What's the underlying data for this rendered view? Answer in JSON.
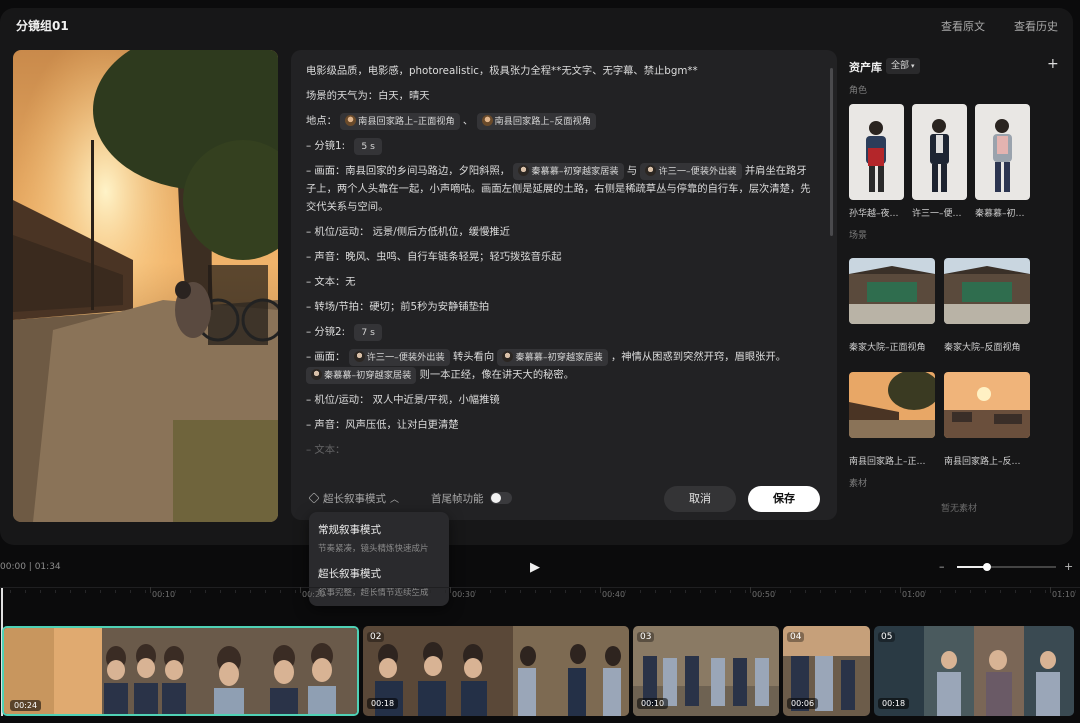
{
  "header": {
    "title": "分镜组01",
    "view_original": "查看原文",
    "view_history": "查看历史"
  },
  "editor": {
    "line1": "电影级品质，电影感，photorealistic，极具张力全程**无文字、无字幕、禁止bgm**",
    "weather": "场景的天气为：白天，晴天",
    "location_label": "地点：",
    "location_chip1": "南县回家路上–正面视角",
    "location_sep": "、",
    "location_chip2": "南县回家路上–反面视角",
    "shot1_label": "– 分镜1:",
    "shot1_duration": "5 s",
    "shot1_scene_a": "– 画面：南县回家的乡间马路边，夕阳斜照，",
    "shot1_chip_a": "秦慕慕–初穿越家居装",
    "shot1_scene_b": "与",
    "shot1_chip_b": "许三一–便装外出装",
    "shot1_scene_c": "并肩坐在路牙子上，两个人头靠在一起，小声嘀咕。画面左侧是延展的土路，右侧是稀疏草丛与停靠的自行车，层次清楚，先交代关系与空间。",
    "shot1_camera": "– 机位/运动：  远景/侧后方低机位，缓慢推近",
    "shot1_sound": "– 声音：晚风、虫鸣、自行车链条轻晃；轻巧拨弦音乐起",
    "shot1_text": "– 文本：无",
    "shot1_transition": "– 转场/节拍：硬切；前5秒为安静铺垫拍",
    "shot2_label": "– 分镜2:",
    "shot2_duration": "7 s",
    "shot2_scene_a": "– 画面：",
    "shot2_chip_a": "许三一–便装外出装",
    "shot2_scene_b": "转头看向",
    "shot2_chip_b": "秦慕慕–初穿越家居装",
    "shot2_scene_c": "，神情从困惑到突然开窍，眉眼张开。",
    "shot2_chip_c": "秦慕慕–初穿越家居装",
    "shot2_scene_d": "则一本正经，像在讲天大的秘密。",
    "shot2_camera": "– 机位/运动：  双人中近景/平视，小幅推镜",
    "shot2_sound": "– 声音：风声压低，让对白更清楚",
    "shot2_text_partial": "– 文本："
  },
  "footer": {
    "mode_label": "超长叙事模式",
    "tail_frame_label": "首尾帧功能",
    "tail_frame_on": false,
    "cancel": "取消",
    "save": "保存"
  },
  "mode_menu": {
    "items": [
      {
        "title": "常规叙事模式",
        "desc": "节奏紧凑，镜头精炼快速成片"
      },
      {
        "title": "超长叙事模式",
        "desc": "叙事完整，超长情节连续生成"
      }
    ]
  },
  "assets": {
    "title": "资产库",
    "filter": "全部",
    "section_roles": "角色",
    "roles": [
      "孙华越–夜…",
      "许三一–便…",
      "秦慕慕–初…"
    ],
    "section_scenes": "场景",
    "scenes": [
      "秦家大院–正面视角",
      "秦家大院–反面视角",
      "南县回家路上–正…",
      "南县回家路上–反…"
    ],
    "section_material": "素材",
    "no_material": "暂无素材"
  },
  "timeline": {
    "current_time": "00:00",
    "total_time": "01:34",
    "zoom_level": 0.3,
    "ticks": [
      "00:10",
      "00:20",
      "00:30",
      "00:40",
      "00:50",
      "01:00",
      "01:10"
    ],
    "clips": [
      {
        "num": "01",
        "time": "00:24"
      },
      {
        "num": "02",
        "time": "00:18"
      },
      {
        "num": "03",
        "time": "00:10"
      },
      {
        "num": "04",
        "time": "00:06"
      },
      {
        "num": "05",
        "time": "00:18"
      }
    ]
  },
  "colors": {
    "accent_selected": "#4fd1b5",
    "panel_bg": "#171718"
  }
}
